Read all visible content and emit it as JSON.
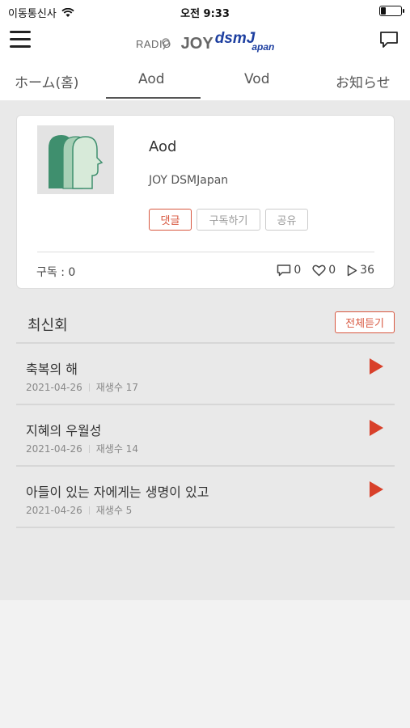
{
  "status_bar": {
    "carrier": "이동통신사",
    "time": "오전 9:33"
  },
  "header": {
    "logo_radio": "RADIO",
    "logo_joy": "JOY",
    "logo_dsmj": "dsmJ",
    "logo_japan": "apan"
  },
  "tabs": [
    {
      "label": "ホーム(홈)"
    },
    {
      "label": "Aod"
    },
    {
      "label": "Vod"
    },
    {
      "label": "お知らせ"
    }
  ],
  "active_tab": "Aod",
  "program": {
    "title": "Aod",
    "channel": "JOY DSMJapan",
    "buttons": {
      "comment": "댓글",
      "subscribe": "구독하기",
      "share": "공유"
    },
    "subscribers_label": "구독 : 0",
    "comments": "0",
    "likes": "0",
    "plays": "36"
  },
  "latest": {
    "title": "최신회",
    "listen_all": "전체듣기",
    "episodes": [
      {
        "title": "축복의 해",
        "date": "2021-04-26",
        "plays": "재생수 17"
      },
      {
        "title": "지혜의 우월성",
        "date": "2021-04-26",
        "plays": "재생수 14"
      },
      {
        "title": "아들이 있는 자에게는 생명이 있고",
        "date": "2021-04-26",
        "plays": "재생수 5"
      }
    ]
  },
  "colors": {
    "accent": "#d8573f",
    "brand_blue": "#1d3fa0",
    "thumb_green": "#4e9b7a"
  }
}
